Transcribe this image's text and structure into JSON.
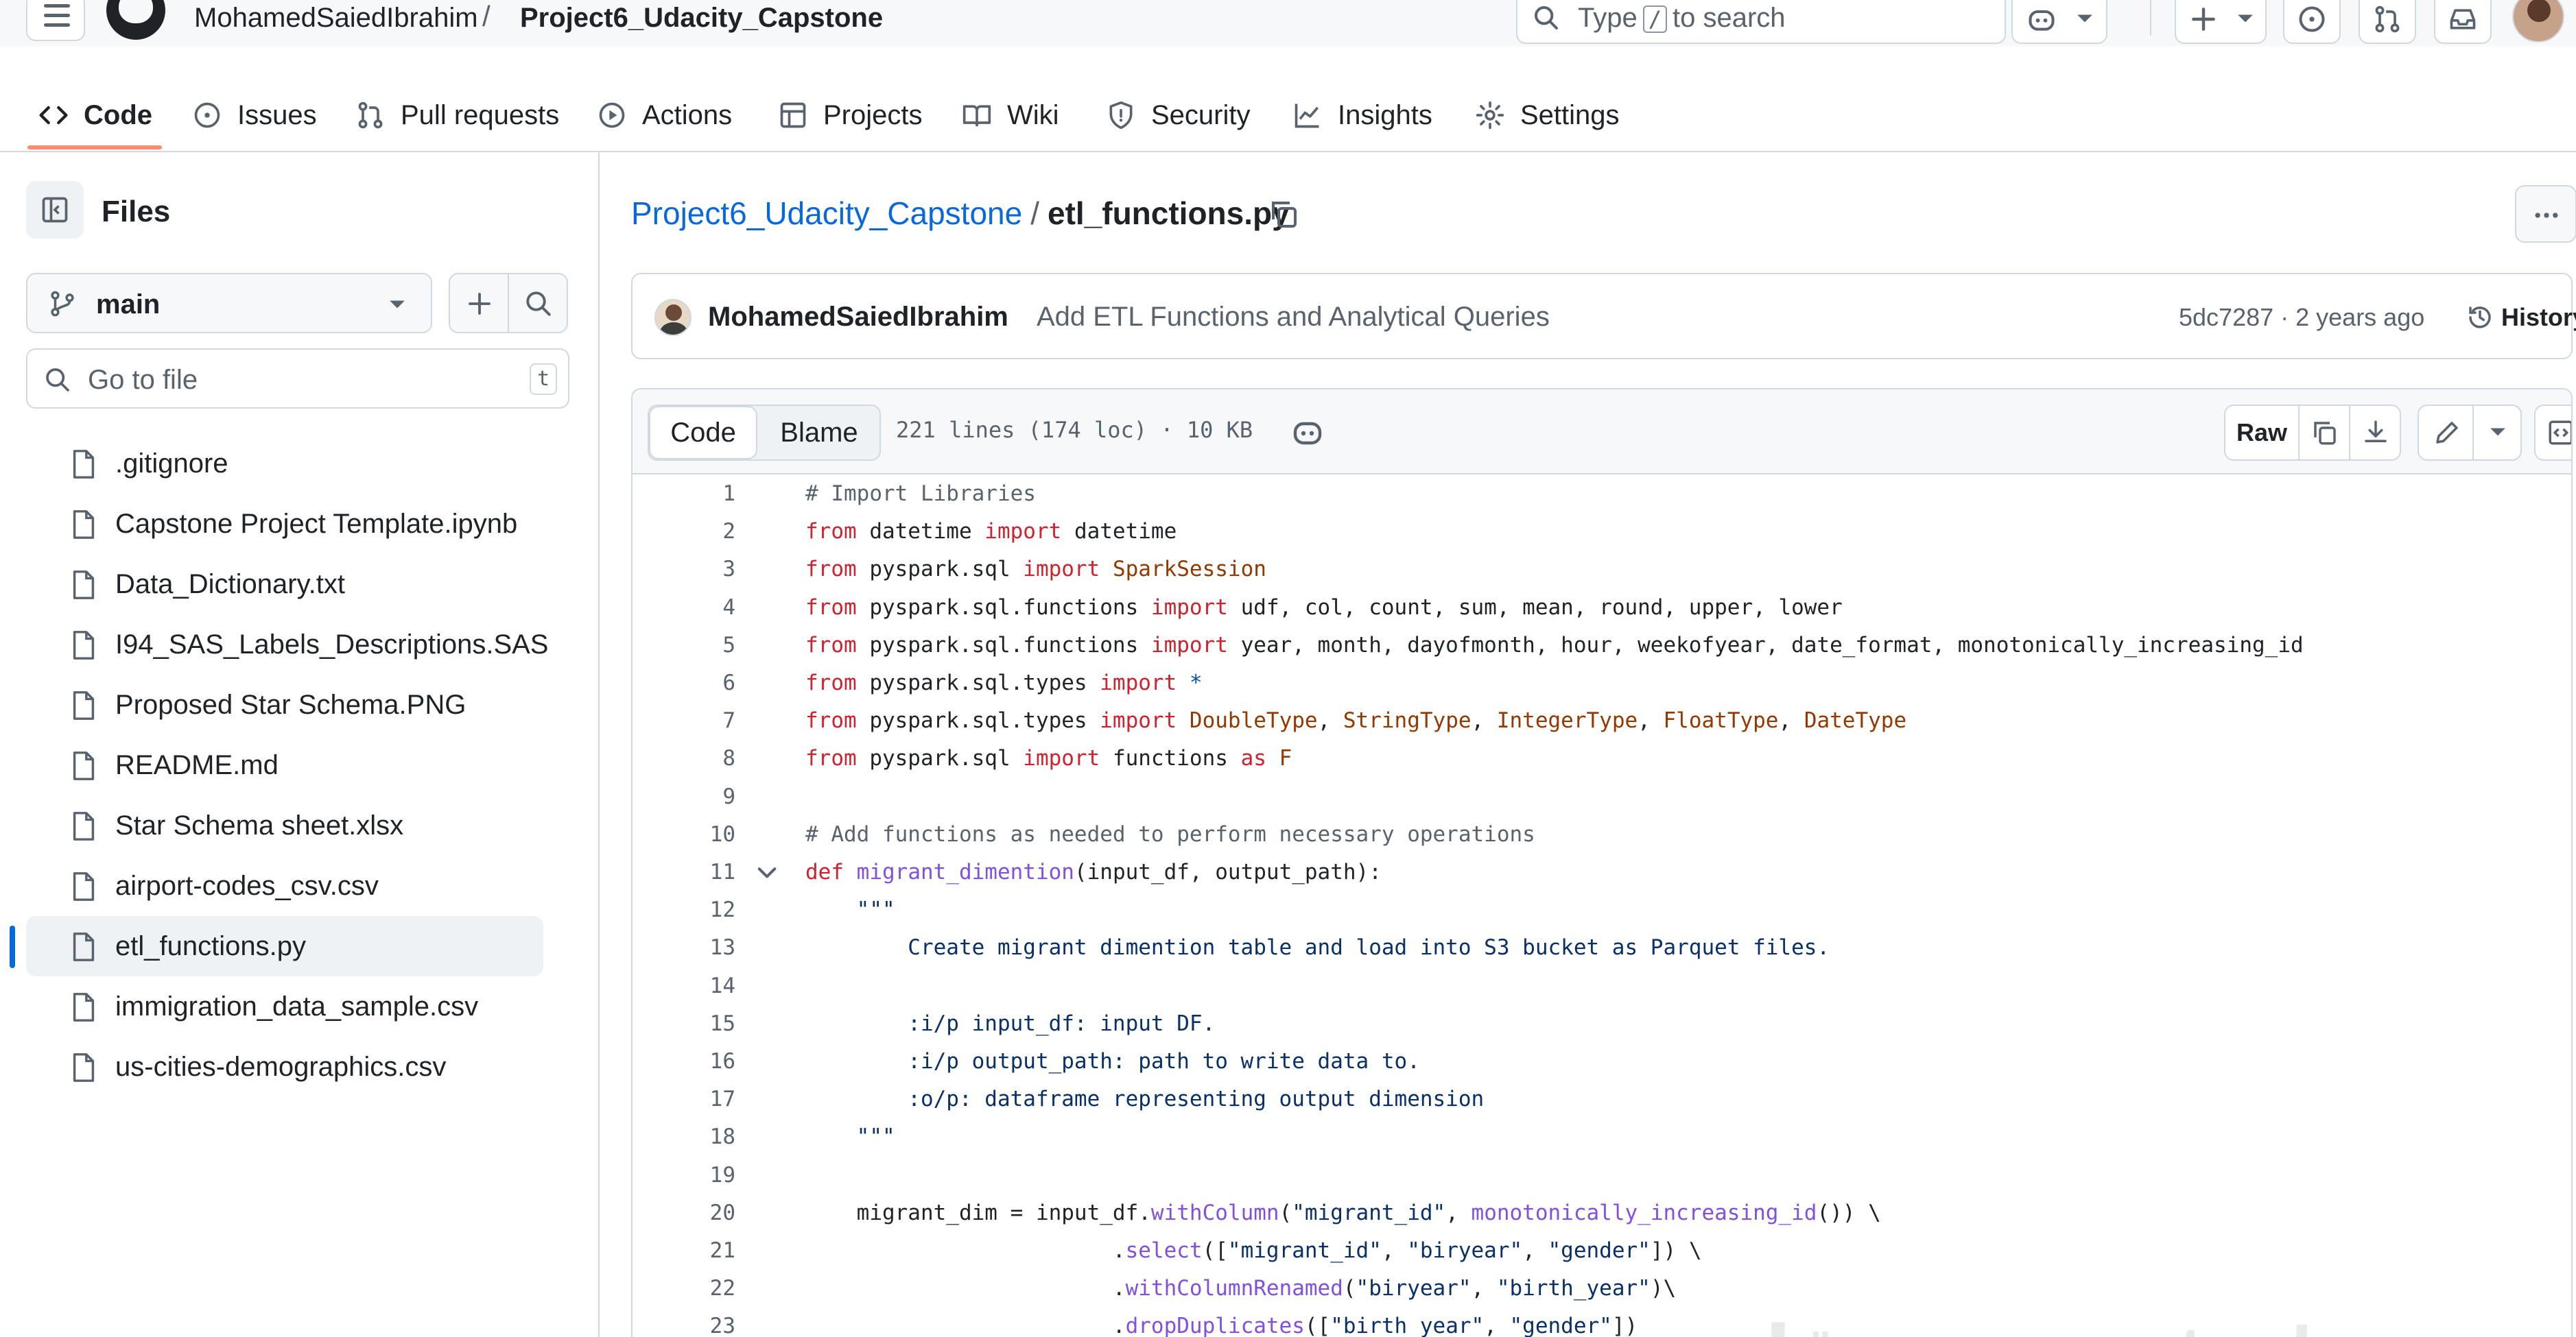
{
  "header": {
    "owner": "MohamedSaiedIbrahim",
    "separator": "/",
    "repo": "Project6_Udacity_Capstone",
    "search": {
      "before": "Type",
      "key": "/",
      "after": "to search"
    }
  },
  "repo_nav": {
    "tabs": [
      {
        "label": "Code",
        "icon": "code-icon",
        "active": true
      },
      {
        "label": "Issues",
        "icon": "issue-icon"
      },
      {
        "label": "Pull requests",
        "icon": "pull-request-icon"
      },
      {
        "label": "Actions",
        "icon": "play-icon"
      },
      {
        "label": "Projects",
        "icon": "table-icon"
      },
      {
        "label": "Wiki",
        "icon": "book-icon"
      },
      {
        "label": "Security",
        "icon": "shield-icon"
      },
      {
        "label": "Insights",
        "icon": "graph-icon"
      },
      {
        "label": "Settings",
        "icon": "gear-icon"
      }
    ],
    "accent_color": "#fd8c73"
  },
  "sidebar": {
    "title": "Files",
    "branch": "main",
    "go_to_file_placeholder": "Go to file",
    "go_to_file_shortcut": "t",
    "files": [
      {
        "name": ".gitignore"
      },
      {
        "name": "Capstone Project Template.ipynb"
      },
      {
        "name": "Data_Dictionary.txt"
      },
      {
        "name": "I94_SAS_Labels_Descriptions.SAS"
      },
      {
        "name": "Proposed Star Schema.PNG"
      },
      {
        "name": "README.md"
      },
      {
        "name": "Star Schema sheet.xlsx"
      },
      {
        "name": "airport-codes_csv.csv"
      },
      {
        "name": "etl_functions.py",
        "active": true
      },
      {
        "name": "immigration_data_sample.csv"
      },
      {
        "name": "us-cities-demographics.csv"
      }
    ]
  },
  "main": {
    "breadcrumb": {
      "repo": "Project6_Udacity_Capstone",
      "separator": "/",
      "file": "etl_functions.py"
    },
    "commit": {
      "author": "MohamedSaiedIbrahim",
      "message": "Add ETL Functions and Analytical Queries",
      "meta": "5dc7287 · 2 years ago",
      "history_label": "History"
    },
    "viewer": {
      "code_tab": "Code",
      "blame_tab": "Blame",
      "file_info": "221 lines (174 loc) · 10 KB",
      "raw_label": "Raw"
    },
    "code_lines": [
      {
        "n": "1",
        "tokens": [
          [
            "cm",
            "# Import Libraries"
          ]
        ]
      },
      {
        "n": "2",
        "tokens": [
          [
            "kw",
            "from"
          ],
          [
            "",
            " datetime "
          ],
          [
            "kw",
            "import"
          ],
          [
            "",
            " datetime"
          ]
        ]
      },
      {
        "n": "3",
        "tokens": [
          [
            "kw",
            "from"
          ],
          [
            "",
            " pyspark.sql "
          ],
          [
            "kw",
            "import"
          ],
          [
            "",
            " "
          ],
          [
            "cl",
            "SparkSession"
          ]
        ]
      },
      {
        "n": "4",
        "tokens": [
          [
            "kw",
            "from"
          ],
          [
            "",
            " pyspark.sql.functions "
          ],
          [
            "kw",
            "import"
          ],
          [
            "",
            " udf, col, count, sum, mean, round, upper, lower"
          ]
        ]
      },
      {
        "n": "5",
        "tokens": [
          [
            "kw",
            "from"
          ],
          [
            "",
            " pyspark.sql.functions "
          ],
          [
            "kw",
            "import"
          ],
          [
            "",
            " year, month, dayofmonth, hour, weekofyear, date_format, monotonically_increasing_id"
          ]
        ]
      },
      {
        "n": "6",
        "tokens": [
          [
            "kw",
            "from"
          ],
          [
            "",
            " pyspark.sql.types "
          ],
          [
            "kw",
            "import"
          ],
          [
            "",
            " "
          ],
          [
            "co",
            "*"
          ]
        ]
      },
      {
        "n": "7",
        "tokens": [
          [
            "kw",
            "from"
          ],
          [
            "",
            " pyspark.sql.types "
          ],
          [
            "kw",
            "import"
          ],
          [
            "",
            " "
          ],
          [
            "cl",
            "DoubleType"
          ],
          [
            "",
            ", "
          ],
          [
            "cl",
            "StringType"
          ],
          [
            "",
            ", "
          ],
          [
            "cl",
            "IntegerType"
          ],
          [
            "",
            ", "
          ],
          [
            "cl",
            "FloatType"
          ],
          [
            "",
            ", "
          ],
          [
            "cl",
            "DateType"
          ]
        ]
      },
      {
        "n": "8",
        "tokens": [
          [
            "kw",
            "from"
          ],
          [
            "",
            " pyspark.sql "
          ],
          [
            "kw",
            "import"
          ],
          [
            "",
            " functions "
          ],
          [
            "kw",
            "as"
          ],
          [
            "",
            " "
          ],
          [
            "cl",
            "F"
          ]
        ]
      },
      {
        "n": "9",
        "tokens": []
      },
      {
        "n": "10",
        "tokens": [
          [
            "cm",
            "# Add functions as needed to perform necessary operations"
          ]
        ]
      },
      {
        "n": "11",
        "fold": true,
        "tokens": [
          [
            "kw",
            "def"
          ],
          [
            "",
            " "
          ],
          [
            "fn",
            "migrant_dimention"
          ],
          [
            "",
            "(input_df, output_path):"
          ]
        ]
      },
      {
        "n": "12",
        "tokens": [
          [
            "st",
            "    \"\"\""
          ]
        ]
      },
      {
        "n": "13",
        "tokens": [
          [
            "st",
            "        Create migrant dimention table and load into S3 bucket as Parquet files."
          ]
        ]
      },
      {
        "n": "14",
        "tokens": []
      },
      {
        "n": "15",
        "tokens": [
          [
            "st",
            "        :i/p input_df: input DF."
          ]
        ]
      },
      {
        "n": "16",
        "tokens": [
          [
            "st",
            "        :i/p output_path: path to write data to."
          ]
        ]
      },
      {
        "n": "17",
        "tokens": [
          [
            "st",
            "        :o/p: dataframe representing output dimension"
          ]
        ]
      },
      {
        "n": "18",
        "tokens": [
          [
            "st",
            "    \"\"\""
          ]
        ]
      },
      {
        "n": "19",
        "tokens": []
      },
      {
        "n": "20",
        "tokens": [
          [
            "",
            "    migrant_dim = input_df."
          ],
          [
            "fn",
            "withColumn"
          ],
          [
            "",
            "("
          ],
          [
            "st",
            "\"migrant_id\""
          ],
          [
            "",
            ", "
          ],
          [
            "fn",
            "monotonically_increasing_id"
          ],
          [
            "",
            "()) \\"
          ]
        ]
      },
      {
        "n": "21",
        "tokens": [
          [
            "",
            "                        ."
          ],
          [
            "fn",
            "select"
          ],
          [
            "",
            "(["
          ],
          [
            "st",
            "\"migrant_id\""
          ],
          [
            "",
            ", "
          ],
          [
            "st",
            "\"biryear\""
          ],
          [
            "",
            ", "
          ],
          [
            "st",
            "\"gender\""
          ],
          [
            "",
            "]) \\"
          ]
        ]
      },
      {
        "n": "22",
        "tokens": [
          [
            "",
            "                        ."
          ],
          [
            "fn",
            "withColumnRenamed"
          ],
          [
            "",
            "("
          ],
          [
            "st",
            "\"biryear\""
          ],
          [
            "",
            ", "
          ],
          [
            "st",
            "\"birth_year\""
          ],
          [
            "",
            ")\\"
          ]
        ]
      },
      {
        "n": "23",
        "tokens": [
          [
            "",
            "                        ."
          ],
          [
            "fn",
            "dropDuplicates"
          ],
          [
            "",
            "(["
          ],
          [
            "st",
            "\"birth_year\""
          ],
          [
            "",
            ", "
          ],
          [
            "st",
            "\"gender\""
          ],
          [
            "",
            "])"
          ]
        ]
      }
    ]
  },
  "watermark": "مستقل mostaql.com"
}
